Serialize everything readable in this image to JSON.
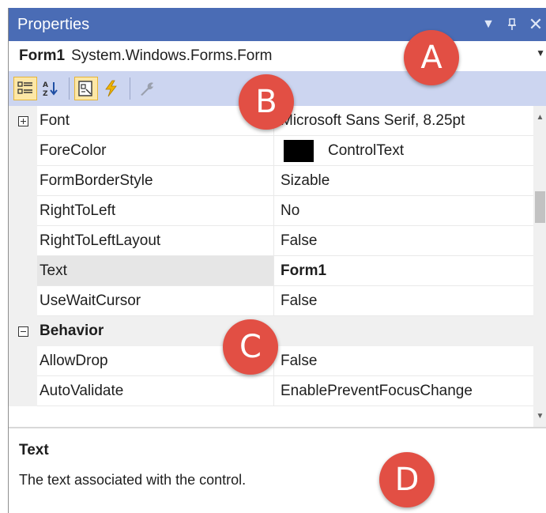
{
  "window": {
    "title": "Properties"
  },
  "object_selector": {
    "name": "Form1",
    "type": "System.Windows.Forms.Form"
  },
  "toolbar": {
    "buttons": [
      {
        "icon": "categorized-icon",
        "active": true
      },
      {
        "icon": "alphabetical-sort-icon",
        "active": false
      },
      {
        "icon": "properties-icon",
        "active": true
      },
      {
        "icon": "events-lightning-icon",
        "active": false
      },
      {
        "icon": "property-pages-wrench-icon",
        "active": false
      }
    ]
  },
  "grid": {
    "rows": [
      {
        "name": "Font",
        "value": "Microsoft Sans Serif, 8.25pt",
        "expander": "plus"
      },
      {
        "name": "ForeColor",
        "value": "ControlText",
        "swatch": "#000000"
      },
      {
        "name": "FormBorderStyle",
        "value": "Sizable"
      },
      {
        "name": "RightToLeft",
        "value": "No"
      },
      {
        "name": "RightToLeftLayout",
        "value": "False"
      },
      {
        "name": "Text",
        "value": "Form1",
        "selected": true,
        "bold_value": true
      },
      {
        "name": "UseWaitCursor",
        "value": "False"
      },
      {
        "name": "Behavior",
        "category": true,
        "expander": "minus"
      },
      {
        "name": "AllowDrop",
        "value": "False"
      },
      {
        "name": "AutoValidate",
        "value": "EnablePreventFocusChange"
      }
    ]
  },
  "description": {
    "title": "Text",
    "text": "The text associated with the control."
  },
  "callouts": {
    "a": "A",
    "b": "B",
    "c": "C",
    "d": "D"
  },
  "colors": {
    "titlebar": "#4a6cb5",
    "toolbar": "#ccd5f0",
    "callout": "#e24f44"
  }
}
